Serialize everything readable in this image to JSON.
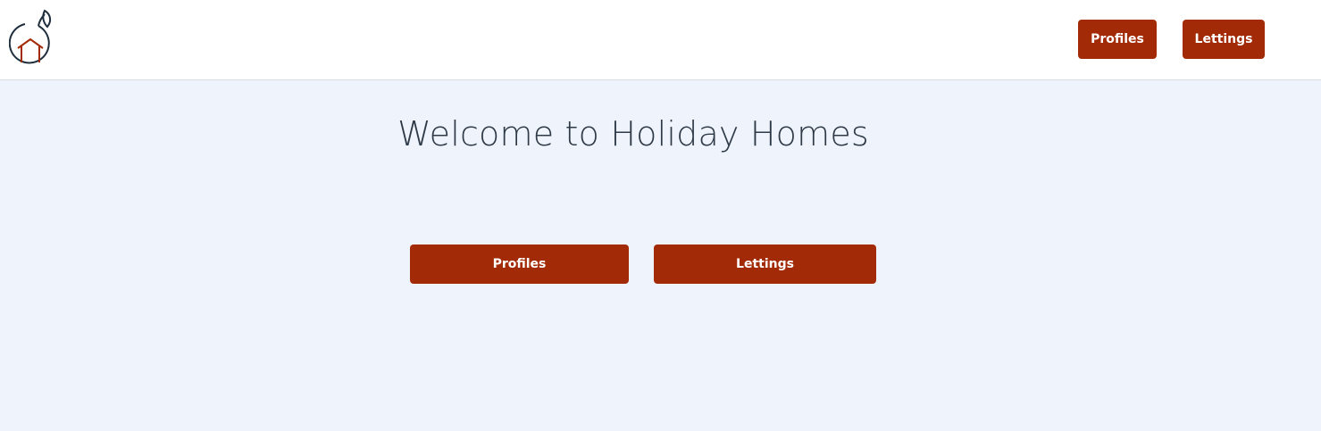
{
  "header": {
    "logo_icon": "house-leaf-logo-icon",
    "nav": {
      "profiles_label": "Profiles",
      "lettings_label": "Lettings"
    }
  },
  "main": {
    "title": "Welcome to Holiday Homes",
    "buttons": {
      "profiles_label": "Profiles",
      "lettings_label": "Lettings"
    }
  },
  "colors": {
    "accent": "#a32a06",
    "page_background": "#eff3fb",
    "header_background": "#ffffff",
    "title_text": "#2e3a48",
    "logo_outline": "#1f2e3d"
  }
}
